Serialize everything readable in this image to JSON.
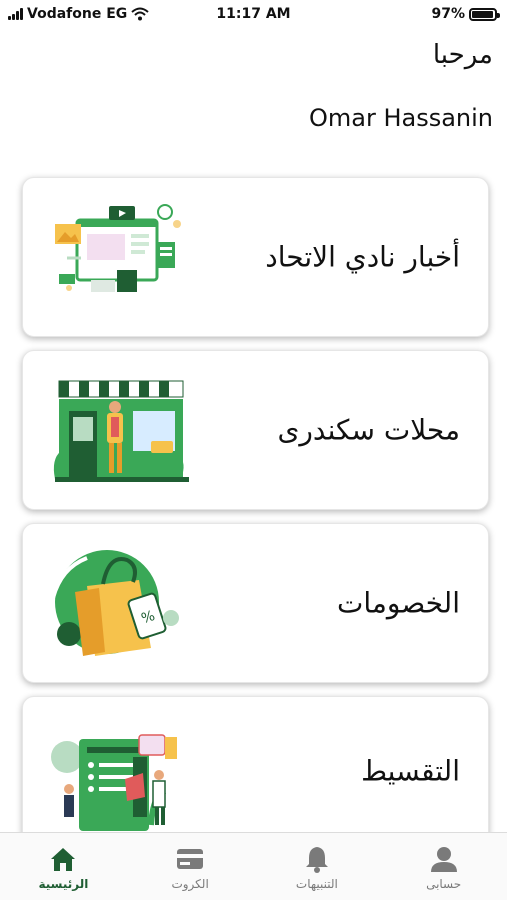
{
  "status_bar": {
    "carrier": "Vodafone EG",
    "time": "11:17 AM",
    "battery": "97%",
    "battery_level": 0.97
  },
  "header": {
    "greeting": "مرحبا",
    "user_name": "Omar Hassanin"
  },
  "cards": [
    {
      "title": "أخبار نادي الاتحاد",
      "icon": "news-illustration"
    },
    {
      "title": "محلات سكندرى",
      "icon": "shop-illustration"
    },
    {
      "title": "الخصومات",
      "icon": "shopping-bag-illustration"
    },
    {
      "title": "التقسيط",
      "icon": "installment-illustration"
    }
  ],
  "tabs": [
    {
      "label": "حسابى",
      "icon": "person-icon"
    },
    {
      "label": "التنبيهات",
      "icon": "bell-icon"
    },
    {
      "label": "الكروت",
      "icon": "card-icon"
    },
    {
      "label": "الرئيسية",
      "icon": "home-icon",
      "active": true
    }
  ],
  "colors": {
    "brand_green": "#1f5e33",
    "accent_green": "#3aa857",
    "inactive_gray": "#7a7a7a"
  }
}
